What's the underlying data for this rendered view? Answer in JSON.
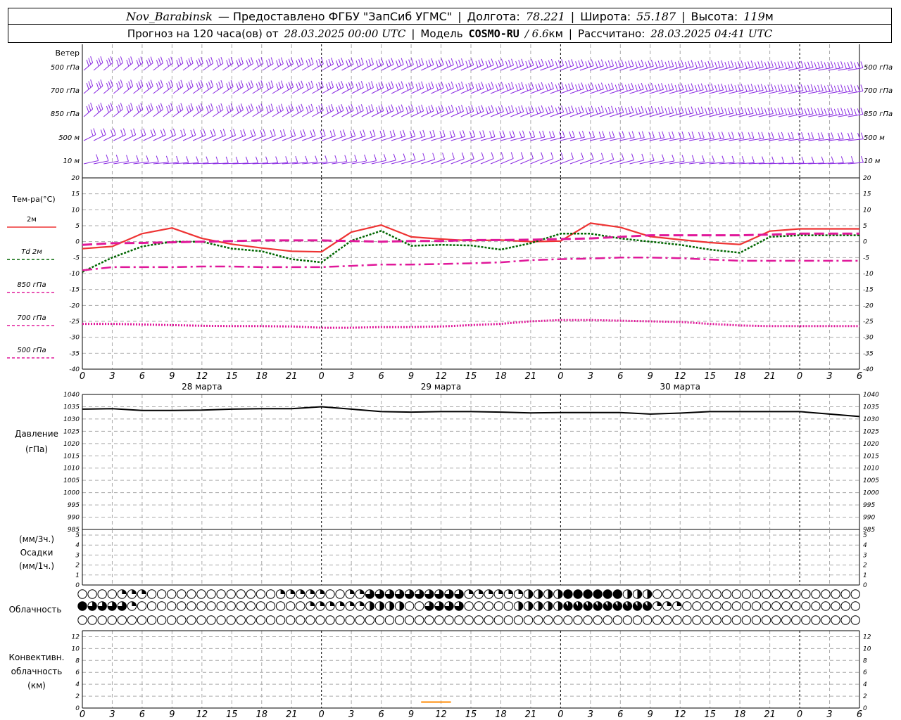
{
  "header": {
    "station": "Nov_Barabinsk",
    "provider": "— Предоставлено ФГБУ \"ЗапСиб УГМС\"",
    "lon_label": "Долгота:",
    "lon_value": "78.221",
    "lat_label": "Широта:",
    "lat_value": "55.187",
    "alt_label": "Высота:",
    "alt_value": "119",
    "alt_unit": "м",
    "forecast_label": "Прогноз на 120 часа(ов) от",
    "forecast_time": "28.03.2025 00:00 UTC",
    "model_label": "Модель",
    "model_name": "COSMO-RU",
    "model_res": "/ 6.6",
    "model_res_unit": "км",
    "calc_label": "Рассчитано:",
    "calc_time": "28.03.2025 04:41 UTC"
  },
  "colors": {
    "wind": "#8a2be2",
    "t2m": "#ee3333",
    "td2m": "#006600",
    "t850": "#e0189a",
    "t700": "#e0189a",
    "t500": "#e0189a",
    "pressure": "#000000",
    "convective": "#ff8800",
    "grid": "#aaaaaa"
  },
  "chart_data": [
    {
      "type": "wind-barbs",
      "title": "Ветер",
      "levels": [
        "500 гПа",
        "700 гПа",
        "850 гПа",
        "500 м",
        "10 м"
      ]
    },
    {
      "type": "line",
      "ylabel": "Тем-ра(°C)",
      "ylim": [
        -40,
        20
      ],
      "yticks": [
        20,
        15,
        10,
        5,
        0,
        -5,
        -10,
        -15,
        -20,
        -25,
        -30,
        -35,
        -40
      ],
      "x_hours": [
        0,
        3,
        6,
        9,
        12,
        15,
        18,
        21,
        24,
        27,
        30,
        33,
        36,
        39,
        42,
        45,
        48,
        51,
        54,
        57,
        60,
        63,
        66,
        69,
        72,
        75,
        78
      ],
      "series": [
        {
          "name": "2м",
          "values": [
            -2.2,
            -1.5,
            2.5,
            4.3,
            1.0,
            -0.8,
            -2.0,
            -3.0,
            -3.2,
            3.0,
            5.2,
            1.5,
            0.8,
            0.3,
            0.5,
            0.0,
            0.2,
            5.8,
            4.5,
            1.6,
            0.6,
            -0.3,
            -0.9,
            3.3,
            4.0,
            4.0,
            4.0
          ]
        },
        {
          "name": "Td 2м",
          "values": [
            -9.5,
            -5.0,
            -1.5,
            0.0,
            0.0,
            -2.2,
            -3.0,
            -5.5,
            -6.5,
            0.3,
            3.4,
            -1.3,
            -1.0,
            -1.2,
            -2.5,
            -0.5,
            2.5,
            2.5,
            1.0,
            0.0,
            -1.0,
            -2.5,
            -3.5,
            1.5,
            2.0,
            2.0,
            2.0
          ]
        },
        {
          "name": "850 гПа",
          "values": [
            -9.0,
            -8.0,
            -8.0,
            -8.0,
            -7.8,
            -7.8,
            -8.0,
            -8.0,
            -8.0,
            -7.6,
            -7.2,
            -7.2,
            -7.0,
            -6.8,
            -6.5,
            -5.8,
            -5.5,
            -5.3,
            -5.0,
            -5.0,
            -5.2,
            -5.6,
            -6.0,
            -6.0,
            -6.0,
            -6.0,
            -6.0
          ]
        },
        {
          "name": "700 гПа",
          "values": [
            -1.0,
            -0.5,
            -0.4,
            -0.2,
            0.0,
            0.2,
            0.4,
            0.4,
            0.4,
            0.2,
            0.0,
            0.2,
            0.2,
            0.5,
            0.5,
            0.6,
            0.8,
            1.0,
            1.5,
            2.0,
            2.0,
            2.0,
            2.0,
            2.2,
            2.5,
            2.5,
            2.5
          ]
        },
        {
          "name": "500 гПа",
          "values": [
            -25.8,
            -25.8,
            -26.0,
            -26.2,
            -26.4,
            -26.5,
            -26.5,
            -26.6,
            -27.0,
            -27.0,
            -26.8,
            -26.8,
            -26.6,
            -26.2,
            -25.8,
            -25.0,
            -24.6,
            -24.6,
            -24.8,
            -25.0,
            -25.2,
            -25.8,
            -26.3,
            -26.5,
            -26.5,
            -26.5,
            -26.5
          ]
        }
      ],
      "xtick_labels": [
        "0",
        "3",
        "6",
        "9",
        "12",
        "15",
        "18",
        "21",
        "0",
        "3",
        "6",
        "9",
        "12",
        "15",
        "18",
        "21",
        "0",
        "3",
        "6",
        "9",
        "12",
        "15",
        "18",
        "21",
        "0",
        "3",
        "6"
      ],
      "date_labels": [
        "28 марта",
        "29 марта",
        "30 марта"
      ]
    },
    {
      "type": "line",
      "ylabel": "Давление (гПа)",
      "ylim": [
        985,
        1040
      ],
      "yticks": [
        1040,
        1035,
        1030,
        1025,
        1020,
        1015,
        1010,
        1005,
        1000,
        995,
        990,
        985
      ],
      "series": [
        {
          "name": "pressure",
          "values": [
            1034.0,
            1034.2,
            1033.5,
            1033.5,
            1033.6,
            1034.0,
            1034.2,
            1034.2,
            1035.0,
            1034.0,
            1033.0,
            1032.8,
            1033.0,
            1033.0,
            1032.8,
            1032.5,
            1032.6,
            1032.6,
            1032.6,
            1032.0,
            1032.4,
            1033.0,
            1033.0,
            1033.0,
            1033.0,
            1032.0,
            1031.0
          ]
        }
      ]
    },
    {
      "type": "bar",
      "ylabel_top": "(мм/3ч.)",
      "ylabel_mid": "Осадки",
      "ylabel_bot": "(мм/1ч.)",
      "ylim": [
        0,
        5
      ],
      "yticks": [
        5,
        4,
        3,
        2,
        1,
        0
      ],
      "values": []
    },
    {
      "type": "table",
      "ylabel": "Облачность",
      "rows": [
        "upper",
        "middle",
        "lower"
      ]
    },
    {
      "type": "bar",
      "ylabel_1": "Конвективн.",
      "ylabel_2": "облачность",
      "ylabel_3": "(км)",
      "ylim": [
        0,
        13
      ],
      "yticks": [
        12,
        10,
        8,
        6,
        4,
        2,
        0
      ],
      "segments": [
        {
          "x_from": 34,
          "x_to": 37,
          "y": 1
        }
      ]
    }
  ]
}
